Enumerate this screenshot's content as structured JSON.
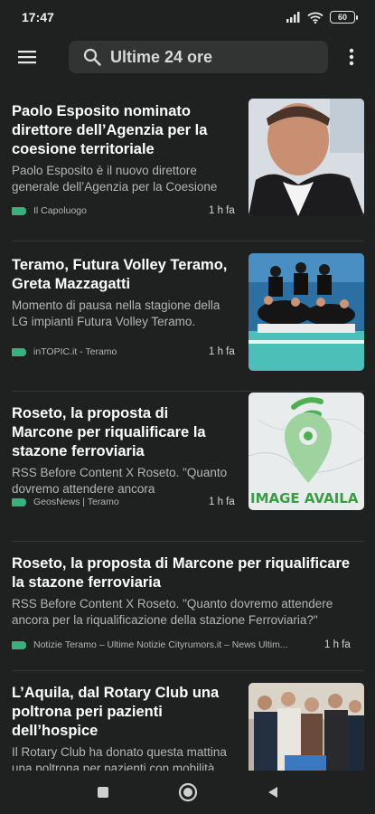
{
  "status_bar": {
    "time": "17:47",
    "battery": "60",
    "icons": [
      "signal-icon",
      "wifi-icon",
      "battery-icon"
    ]
  },
  "app_bar": {
    "menu_icon": "hamburger-menu-icon",
    "search_icon": "search-icon",
    "search_text": "Ultime 24 ore",
    "more_icon": "more-vertical-icon"
  },
  "colors": {
    "background": "#1f2020",
    "search_bg": "#323434",
    "source_tag": "#34b37a",
    "divider": "#363838"
  },
  "articles": [
    {
      "title": "Paolo Esposito nominato direttore dell’Agenzia per la coesione territoriale",
      "snippet": "Paolo Esposito è il nuovo direttore generale dell’Agenzia per la Coesione",
      "source": "Il Capoluogo",
      "time": "1 h fa"
    },
    {
      "title": "Teramo, Futura Volley Teramo, Greta Mazzagatti",
      "snippet": "Momento di pausa nella stagione della LG impianti Futura Volley Teramo.",
      "source": "inTOPIC.it - Teramo",
      "time": "1 h fa"
    },
    {
      "title": "Roseto, la proposta di Marcone per riqualificare la stazone ferroviaria",
      "snippet": "RSS Before Content X Roseto. \"Quanto dovremo attendere ancora",
      "source": "GeosNews | Teramo",
      "time": "1 h fa",
      "image_text": "IMAGE AVAILA"
    },
    {
      "title": "Roseto, la proposta di Marcone per riqualificare la stazone ferroviaria",
      "snippet": "RSS Before Content X Roseto. \"Quanto dovremo attendere ancora per la riqualificazione della stazione Ferroviaria?\"",
      "source": "Notizie Teramo – Ultime Notizie Cityrumors.it – News Ultim...",
      "time": "1 h fa"
    },
    {
      "title": "L’Aquila, dal Rotary Club una poltrona peri pazienti dell’hospice",
      "snippet": "Il Rotary Club ha donato questa mattina una poltrona per pazienti con mobilità",
      "source": "",
      "time": ""
    }
  ],
  "nav_bar": {
    "icons": [
      "recent-apps-icon",
      "home-icon",
      "back-icon"
    ]
  }
}
